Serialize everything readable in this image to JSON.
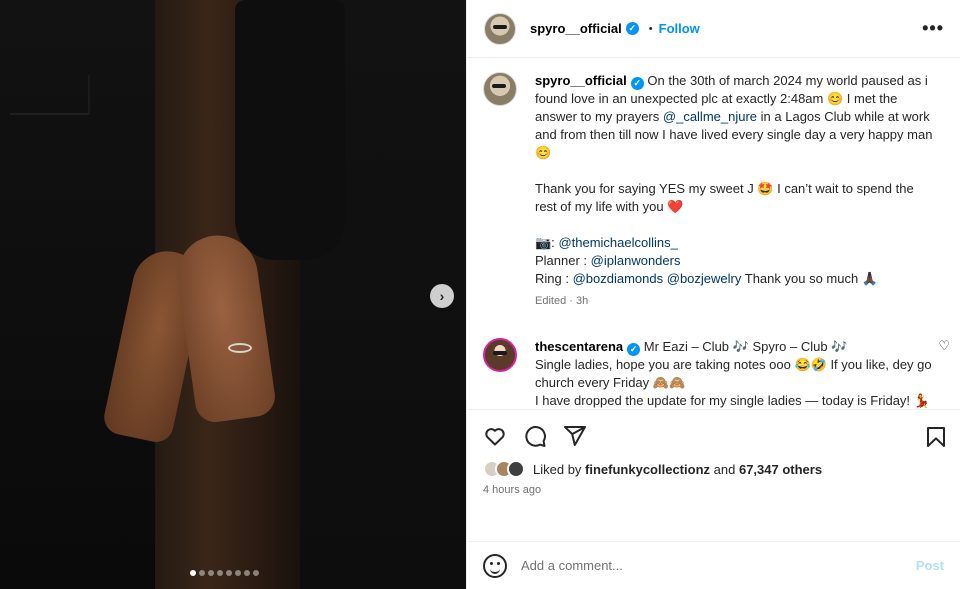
{
  "post": {
    "username": "spyro__official",
    "follow_label": "Follow",
    "separator": "•",
    "more_label": "•••"
  },
  "caption": {
    "username": "spyro__official",
    "line1": "On the 30th of march 2024 my world paused as i found love in an unexpected plc at exactly 2:48am 😊 I met the answer to my prayers",
    "mention1": "@_callme_njure",
    "line1b": "in a Lagos Club while at work and from then till now I have lived every single day a very happy man 😊",
    "line2": "Thank you for saying YES my sweet J 🤩 I can’t wait to spend the rest of my life with you ❤️",
    "camera": "📷:",
    "mention_photo": "@themichaelcollins_",
    "planner_label": "Planner :",
    "mention_planner": "@iplanwonders",
    "ring_label": "Ring :",
    "mention_ring1": "@bozdiamonds",
    "mention_ring2": "@bozjewelry",
    "ring_tail": "Thank you so much 🙏🏿",
    "meta": "Edited · 3h"
  },
  "comment": {
    "username": "thescentarena",
    "text1": "Mr Eazi – Club 🎶 Spyro – Club 🎶",
    "text2": "Single ladies, hope you are taking notes ooo 😂🤣 If you like, dey go church every Friday 🙈🙈",
    "text3": "I have dropped the update for my single ladies — today is Friday! 💃💃"
  },
  "likes": {
    "prefix": "Liked by",
    "user": "finefunkycollectionz",
    "and": "and",
    "count": "67,347 others",
    "time": "4 hours ago"
  },
  "add_comment": {
    "placeholder": "Add a comment...",
    "post_label": "Post"
  },
  "media": {
    "slides": 8,
    "active_slide": 1
  }
}
